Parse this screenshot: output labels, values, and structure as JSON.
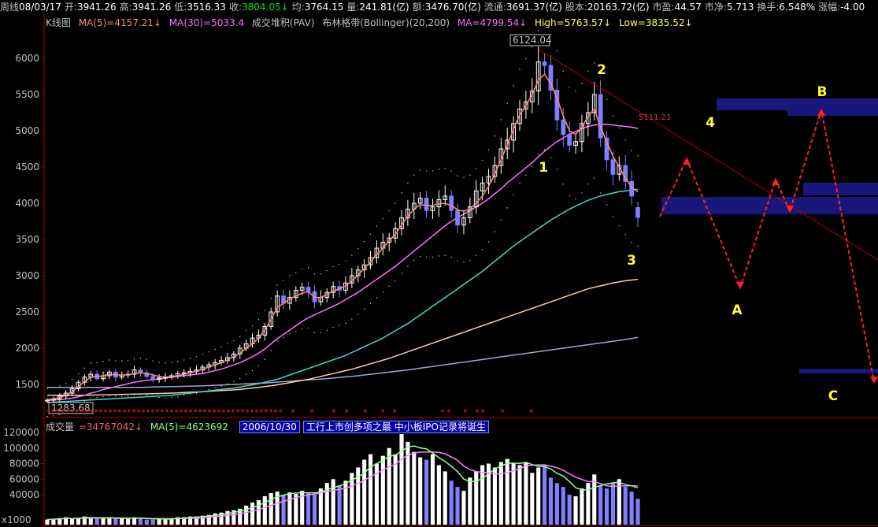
{
  "topbar": {
    "items": [
      {
        "label": "周线",
        "value": "08/03/17",
        "tone": "w"
      },
      {
        "label": "开",
        "value": "3941.26",
        "tone": "w"
      },
      {
        "label": "高",
        "value": "3941.26",
        "tone": "w"
      },
      {
        "label": "低",
        "value": "3516.33",
        "tone": "w"
      },
      {
        "label": "收",
        "value": "3804.05↓",
        "tone": "lo"
      },
      {
        "label": "均",
        "value": "3764.15",
        "tone": "w"
      },
      {
        "label": "量",
        "value": "241.81(亿)",
        "tone": "w"
      },
      {
        "label": "额",
        "value": "3476.70(亿)",
        "tone": "w"
      },
      {
        "label": "流通",
        "value": "3691.37(亿)",
        "tone": "w"
      },
      {
        "label": "股本",
        "value": "20163.72(亿)",
        "tone": "w"
      },
      {
        "label": "市盈",
        "value": "44.57",
        "tone": "w"
      },
      {
        "label": "市净",
        "value": "5.713",
        "tone": "w"
      },
      {
        "label": "换手",
        "value": "6.548%",
        "tone": "w"
      },
      {
        "label": "涨幅",
        "value": "-4.00",
        "tone": "w"
      }
    ]
  },
  "legend": {
    "panel_name": "K线图",
    "ma5": "MA(5)=4157.21↓",
    "ma30": "MA(30)=5033.4",
    "pav": "成交堆积(PAV)",
    "boll": "布林格带(Bollinger)(20,200)",
    "ma": "MA=4799.54↓",
    "high": "High=5763.57↓",
    "low": "Low=3835.52↓"
  },
  "volume_legend": {
    "label": "成交量",
    "value": "=34767042↓",
    "ma5": "MA(5)=4623692",
    "note_date": "2006/10/30",
    "note_text": "工行上市创多项之最  中小板IPO记录将诞生"
  },
  "colors": {
    "bg": "#000000",
    "axis": "#b00000",
    "up": "#ffffff",
    "down": "#7f7fff",
    "ma5": "#ff8a7a",
    "ma_pink": "#ff6eff",
    "ma_cyan": "#48d8c8",
    "ma_beige": "#ffc8b4",
    "ma_steel": "#98a8d0",
    "trend": "#b00000",
    "forecast": "#ff2020",
    "annotation": "#ffff30",
    "volume_bar_up": "#ffffff",
    "volume_bar_down": "#8080ff",
    "vol_ma_green": "#90ff90",
    "vol_ma_pink": "#ff80ff"
  },
  "chart_data": [
    {
      "type": "candlestick",
      "title": "K线图",
      "ylim": [
        1150,
        6300
      ],
      "yticks": [
        1500,
        2000,
        2500,
        3000,
        3500,
        4000,
        4500,
        5000,
        5500,
        6000
      ],
      "weekly_closes": [
        1283,
        1300,
        1340,
        1380,
        1440,
        1530,
        1600,
        1640,
        1580,
        1620,
        1670,
        1600,
        1630,
        1640,
        1700,
        1660,
        1610,
        1570,
        1590,
        1600,
        1620,
        1650,
        1660,
        1680,
        1700,
        1740,
        1770,
        1800,
        1830,
        1870,
        1920,
        2000,
        2060,
        2140,
        2180,
        2300,
        2500,
        2720,
        2620,
        2700,
        2800,
        2840,
        2780,
        2640,
        2700,
        2770,
        2850,
        2800,
        2900,
        3000,
        3080,
        3150,
        3250,
        3380,
        3460,
        3520,
        3650,
        3800,
        3920,
        4000,
        4070,
        3900,
        3950,
        4050,
        4100,
        3900,
        3700,
        3800,
        3950,
        4170,
        4280,
        4370,
        4520,
        4750,
        4870,
        5100,
        5300,
        5400,
        5550,
        5950,
        5900,
        5560,
        5150,
        4950,
        4800,
        4850,
        5100,
        5250,
        5500,
        4900,
        4600,
        4400,
        4520,
        4300,
        4100,
        3804
      ],
      "ma5": [
        1290,
        1300,
        1320,
        1350,
        1400,
        1470,
        1540,
        1600,
        1610,
        1620,
        1640,
        1630,
        1630,
        1630,
        1650,
        1660,
        1650,
        1630,
        1610,
        1600,
        1610,
        1620,
        1640,
        1660,
        1680,
        1710,
        1740,
        1770,
        1800,
        1840,
        1880,
        1930,
        2000,
        2060,
        2140,
        2250,
        2400,
        2560,
        2620,
        2680,
        2720,
        2760,
        2780,
        2700,
        2700,
        2740,
        2790,
        2820,
        2860,
        2930,
        3010,
        3100,
        3190,
        3290,
        3380,
        3480,
        3570,
        3700,
        3820,
        3920,
        3980,
        3970,
        3970,
        3990,
        4000,
        3970,
        3910,
        3890,
        3920,
        4000,
        4100,
        4230,
        4400,
        4600,
        4800,
        5020,
        5220,
        5350,
        5500,
        5700,
        5780,
        5650,
        5450,
        5200,
        5000,
        4950,
        5050,
        5200,
        5300,
        5050,
        4850,
        4650,
        4500,
        4350,
        4220,
        4157
      ],
      "ma_pink": [
        1280,
        1285,
        1290,
        1300,
        1310,
        1330,
        1350,
        1380,
        1400,
        1430,
        1450,
        1470,
        1490,
        1510,
        1530,
        1545,
        1555,
        1565,
        1575,
        1585,
        1600,
        1610,
        1620,
        1630,
        1640,
        1650,
        1670,
        1690,
        1710,
        1740,
        1770,
        1800,
        1840,
        1880,
        1930,
        1990,
        2060,
        2130,
        2190,
        2250,
        2310,
        2370,
        2420,
        2460,
        2500,
        2540,
        2580,
        2620,
        2670,
        2720,
        2770,
        2830,
        2890,
        2950,
        3010,
        3070,
        3130,
        3200,
        3270,
        3340,
        3410,
        3480,
        3550,
        3620,
        3690,
        3750,
        3800,
        3850,
        3900,
        3950,
        4000,
        4060,
        4130,
        4200,
        4280,
        4350,
        4420,
        4490,
        4560,
        4640,
        4720,
        4790,
        4850,
        4900,
        4950,
        4990,
        5030,
        5060,
        5080,
        5090,
        5090,
        5080,
        5070,
        5060,
        5050,
        5033
      ],
      "ma_cyan": [
        1250,
        1255,
        1260,
        1265,
        1270,
        1275,
        1280,
        1285,
        1290,
        1295,
        1300,
        1305,
        1310,
        1315,
        1320,
        1325,
        1330,
        1335,
        1340,
        1345,
        1350,
        1360,
        1370,
        1380,
        1390,
        1400,
        1410,
        1420,
        1430,
        1440,
        1450,
        1465,
        1480,
        1495,
        1510,
        1530,
        1550,
        1570,
        1600,
        1630,
        1660,
        1690,
        1720,
        1750,
        1780,
        1810,
        1840,
        1870,
        1900,
        1940,
        1980,
        2020,
        2060,
        2100,
        2140,
        2190,
        2240,
        2290,
        2340,
        2400,
        2460,
        2520,
        2580,
        2640,
        2700,
        2760,
        2820,
        2880,
        2940,
        3000,
        3060,
        3130,
        3200,
        3270,
        3340,
        3410,
        3470,
        3530,
        3590,
        3650,
        3710,
        3770,
        3820,
        3870,
        3920,
        3960,
        4000,
        4040,
        4070,
        4100,
        4120,
        4140,
        4160,
        4170,
        4180,
        4190
      ],
      "ma_beige": [
        1350,
        1350,
        1350,
        1350,
        1350,
        1350,
        1350,
        1352,
        1354,
        1356,
        1358,
        1360,
        1362,
        1364,
        1366,
        1368,
        1370,
        1372,
        1375,
        1378,
        1380,
        1384,
        1388,
        1392,
        1396,
        1400,
        1405,
        1410,
        1415,
        1420,
        1425,
        1430,
        1440,
        1450,
        1460,
        1470,
        1480,
        1495,
        1510,
        1525,
        1540,
        1555,
        1570,
        1590,
        1610,
        1630,
        1650,
        1670,
        1690,
        1710,
        1735,
        1760,
        1785,
        1810,
        1835,
        1860,
        1890,
        1920,
        1950,
        1980,
        2010,
        2040,
        2070,
        2100,
        2130,
        2160,
        2190,
        2220,
        2250,
        2280,
        2310,
        2340,
        2370,
        2400,
        2430,
        2460,
        2490,
        2520,
        2550,
        2580,
        2610,
        2640,
        2670,
        2700,
        2730,
        2760,
        2790,
        2820,
        2840,
        2860,
        2880,
        2900,
        2915,
        2930,
        2940,
        2950
      ],
      "ma_steel": [
        1460,
        1460,
        1460,
        1460,
        1460,
        1460,
        1460,
        1460,
        1460,
        1460,
        1460,
        1460,
        1460,
        1460,
        1460,
        1460,
        1462,
        1464,
        1466,
        1468,
        1470,
        1472,
        1474,
        1476,
        1478,
        1480,
        1484,
        1488,
        1492,
        1496,
        1500,
        1504,
        1508,
        1512,
        1516,
        1520,
        1526,
        1532,
        1538,
        1544,
        1550,
        1556,
        1562,
        1568,
        1574,
        1580,
        1588,
        1596,
        1604,
        1612,
        1620,
        1630,
        1640,
        1650,
        1660,
        1670,
        1680,
        1690,
        1700,
        1712,
        1724,
        1736,
        1748,
        1760,
        1772,
        1784,
        1796,
        1808,
        1820,
        1832,
        1844,
        1856,
        1868,
        1880,
        1892,
        1904,
        1916,
        1928,
        1940,
        1952,
        1964,
        1976,
        1988,
        2000,
        2012,
        2024,
        2036,
        2048,
        2060,
        2072,
        2084,
        2096,
        2108,
        2120,
        2135,
        2150
      ],
      "peak_label": "6124.04",
      "low_label": "1283.68",
      "trendline_label": "5111.21",
      "annotations": [
        "1",
        "2",
        "3",
        "4",
        "A",
        "B",
        "C"
      ]
    },
    {
      "type": "bar",
      "title": "成交量",
      "ylim": [
        0,
        130000
      ],
      "yticks": [
        40000,
        60000,
        80000,
        100000,
        120000
      ],
      "ylabel": "x1000",
      "values": [
        8000,
        9000,
        10000,
        11000,
        9000,
        10000,
        12000,
        11000,
        9000,
        10000,
        10000,
        9000,
        10000,
        9000,
        11000,
        9000,
        8000,
        8000,
        9000,
        9000,
        10000,
        11000,
        11000,
        12000,
        12000,
        13000,
        14000,
        16000,
        17000,
        19000,
        20000,
        22000,
        26000,
        30000,
        33000,
        38000,
        42000,
        44000,
        40000,
        43000,
        41000,
        45000,
        43000,
        40000,
        48000,
        55000,
        60000,
        52000,
        58000,
        68000,
        75000,
        85000,
        92000,
        80000,
        90000,
        100000,
        92000,
        118000,
        108000,
        95000,
        88000,
        85000,
        92000,
        78000,
        70000,
        58000,
        50000,
        45000,
        62000,
        70000,
        78000,
        80000,
        75000,
        82000,
        86000,
        80000,
        78000,
        82000,
        68000,
        75000,
        78000,
        62000,
        55000,
        50000,
        40000,
        38000,
        48000,
        55000,
        66000,
        52000,
        48000,
        55000,
        60000,
        50000,
        44000,
        34767
      ]
    }
  ]
}
